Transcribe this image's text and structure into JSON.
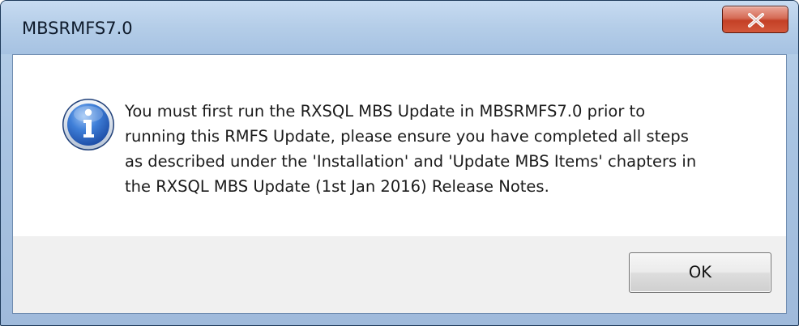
{
  "window": {
    "title": "MBSRMFS7.0",
    "close_icon": "close-icon"
  },
  "dialog": {
    "icon": "info-icon",
    "message_lines": [
      "You must first run the RXSQL MBS Update in MBSRMFS7.0 prior to",
      "running this RMFS Update, please ensure you have completed all steps",
      "as described under the 'Installation' and 'Update MBS Items' chapters in",
      "the RXSQL MBS Update (1st Jan 2016) Release Notes."
    ],
    "ok_label": "OK"
  },
  "colors": {
    "titlebar": "#b4cde8",
    "close_button": "#c44026",
    "client_background": "#f0f0f0",
    "info_icon_blue": "#2a63c4"
  }
}
